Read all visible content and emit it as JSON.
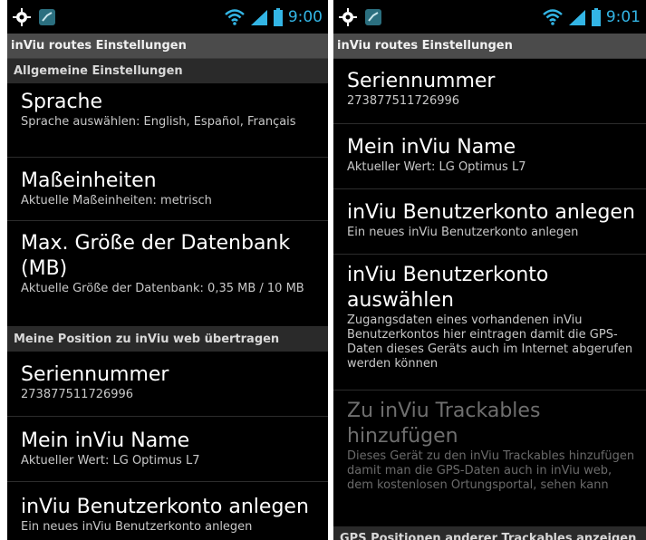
{
  "colors": {
    "accent": "#33b5e5",
    "screen_bg": "#000000",
    "titlebar_bg": "#4b4b4b",
    "section_bg": "#2a2a2a"
  },
  "left": {
    "status": {
      "time": "9:00",
      "icons": [
        "gps-icon",
        "app-icon",
        "wifi-icon",
        "signal-icon",
        "battery-icon"
      ]
    },
    "title": "inViu routes Einstellungen",
    "sections": [
      {
        "header": "Allgemeine Einstellungen"
      },
      {
        "header": "Meine Position zu inViu web übertragen"
      }
    ],
    "items": [
      {
        "title": "Sprache",
        "summary": "Sprache auswählen: English, Español, Français"
      },
      {
        "title": "Maßeinheiten",
        "summary": "Aktuelle Maßeinheiten: metrisch"
      },
      {
        "title": "Max. Größe der Datenbank (MB)",
        "summary": "Aktuelle Größe der Datenbank: 0,35 MB / 10 MB"
      },
      {
        "title": "Seriennummer",
        "summary": "273877511726996"
      },
      {
        "title": "Mein inViu Name",
        "summary": "Aktueller Wert: LG Optimus L7"
      },
      {
        "title": "inViu Benutzerkonto anlegen",
        "summary": "Ein neues inViu Benutzerkonto anlegen"
      }
    ]
  },
  "right": {
    "status": {
      "time": "9:01",
      "icons": [
        "gps-icon",
        "app-icon",
        "wifi-icon",
        "signal-icon",
        "battery-icon"
      ]
    },
    "title": "inViu routes Einstellungen",
    "items": [
      {
        "title": "Seriennummer",
        "summary": "273877511726996"
      },
      {
        "title": "Mein inViu Name",
        "summary": "Aktueller Wert: LG Optimus L7"
      },
      {
        "title": "inViu Benutzerkonto anlegen",
        "summary": "Ein neues inViu Benutzerkonto anlegen"
      },
      {
        "title": "inViu Benutzerkonto auswählen",
        "summary": "Zugangsdaten eines vorhandenen inViu Benutzerkontos hier eintragen damit die GPS-Daten dieses Geräts auch im Internet abgerufen werden können"
      },
      {
        "title": "Zu inViu Trackables hinzufügen",
        "summary": "Dieses Gerät zu den inViu Trackables hinzufügen damit man die GPS-Daten auch in inViu web, dem kostenlosen Ortungsportal, sehen kann"
      }
    ],
    "sections": [
      {
        "header": "GPS Positionen anderer Trackables anzeigen"
      }
    ]
  }
}
